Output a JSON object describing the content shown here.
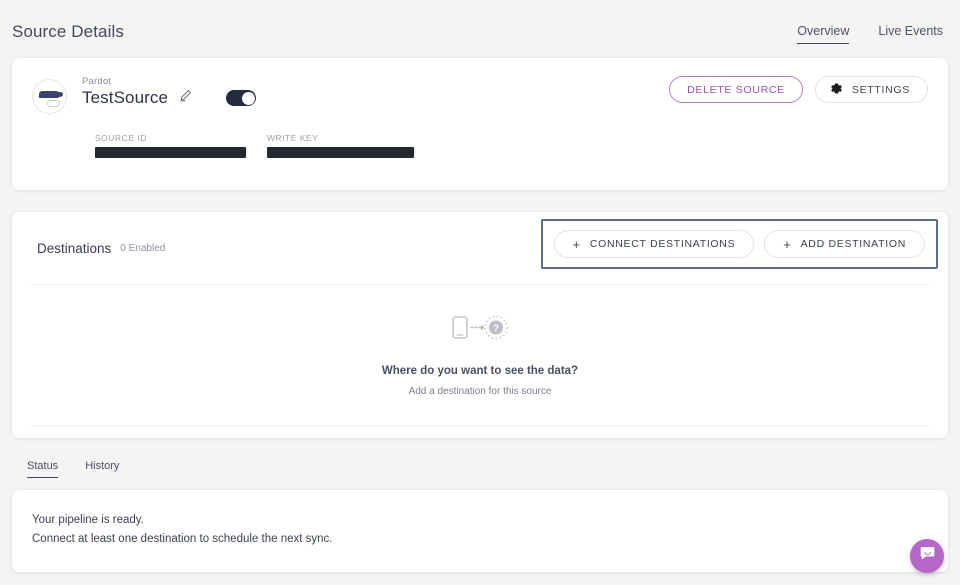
{
  "header": {
    "title": "Source Details",
    "tabs": [
      {
        "label": "Overview",
        "active": true
      },
      {
        "label": "Live Events",
        "active": false
      }
    ]
  },
  "source": {
    "kind": "Pardot",
    "name": "TestSource",
    "enabled": true,
    "edit_icon": "pencil-icon",
    "logo_icon": "pardot-logo-icon",
    "fields": [
      {
        "label": "SOURCE ID",
        "value": "",
        "redacted": true
      },
      {
        "label": "WRITE KEY",
        "value": "",
        "redacted": true
      }
    ],
    "actions": {
      "delete_label": "DELETE SOURCE",
      "settings_label": "SETTINGS",
      "settings_icon": "gear-icon"
    }
  },
  "destinations": {
    "title": "Destinations",
    "count_label": "0 Enabled",
    "connect_label": "CONNECT DESTINATIONS",
    "add_label": "ADD DESTINATION",
    "plus_icon": "plus-icon",
    "empty": {
      "icon": "phone-to-unknown-icon",
      "title": "Where do you want to see the data?",
      "subtitle": "Add a destination for this source"
    }
  },
  "status": {
    "tabs": [
      {
        "label": "Status",
        "active": true
      },
      {
        "label": "History",
        "active": false
      }
    ],
    "lines": [
      "Your pipeline is ready.",
      "Connect at least one destination to schedule the next sync."
    ]
  },
  "chat": {
    "icon": "chat-bubble-icon"
  },
  "colors": {
    "background": "#f4f4f5",
    "card": "#ffffff",
    "text": "#3b4257",
    "accent_purple": "#9d4fc4",
    "highlight_border": "#5d6d8e",
    "toggle_on": "#232b3e",
    "chat_purple": "#b467c9"
  }
}
